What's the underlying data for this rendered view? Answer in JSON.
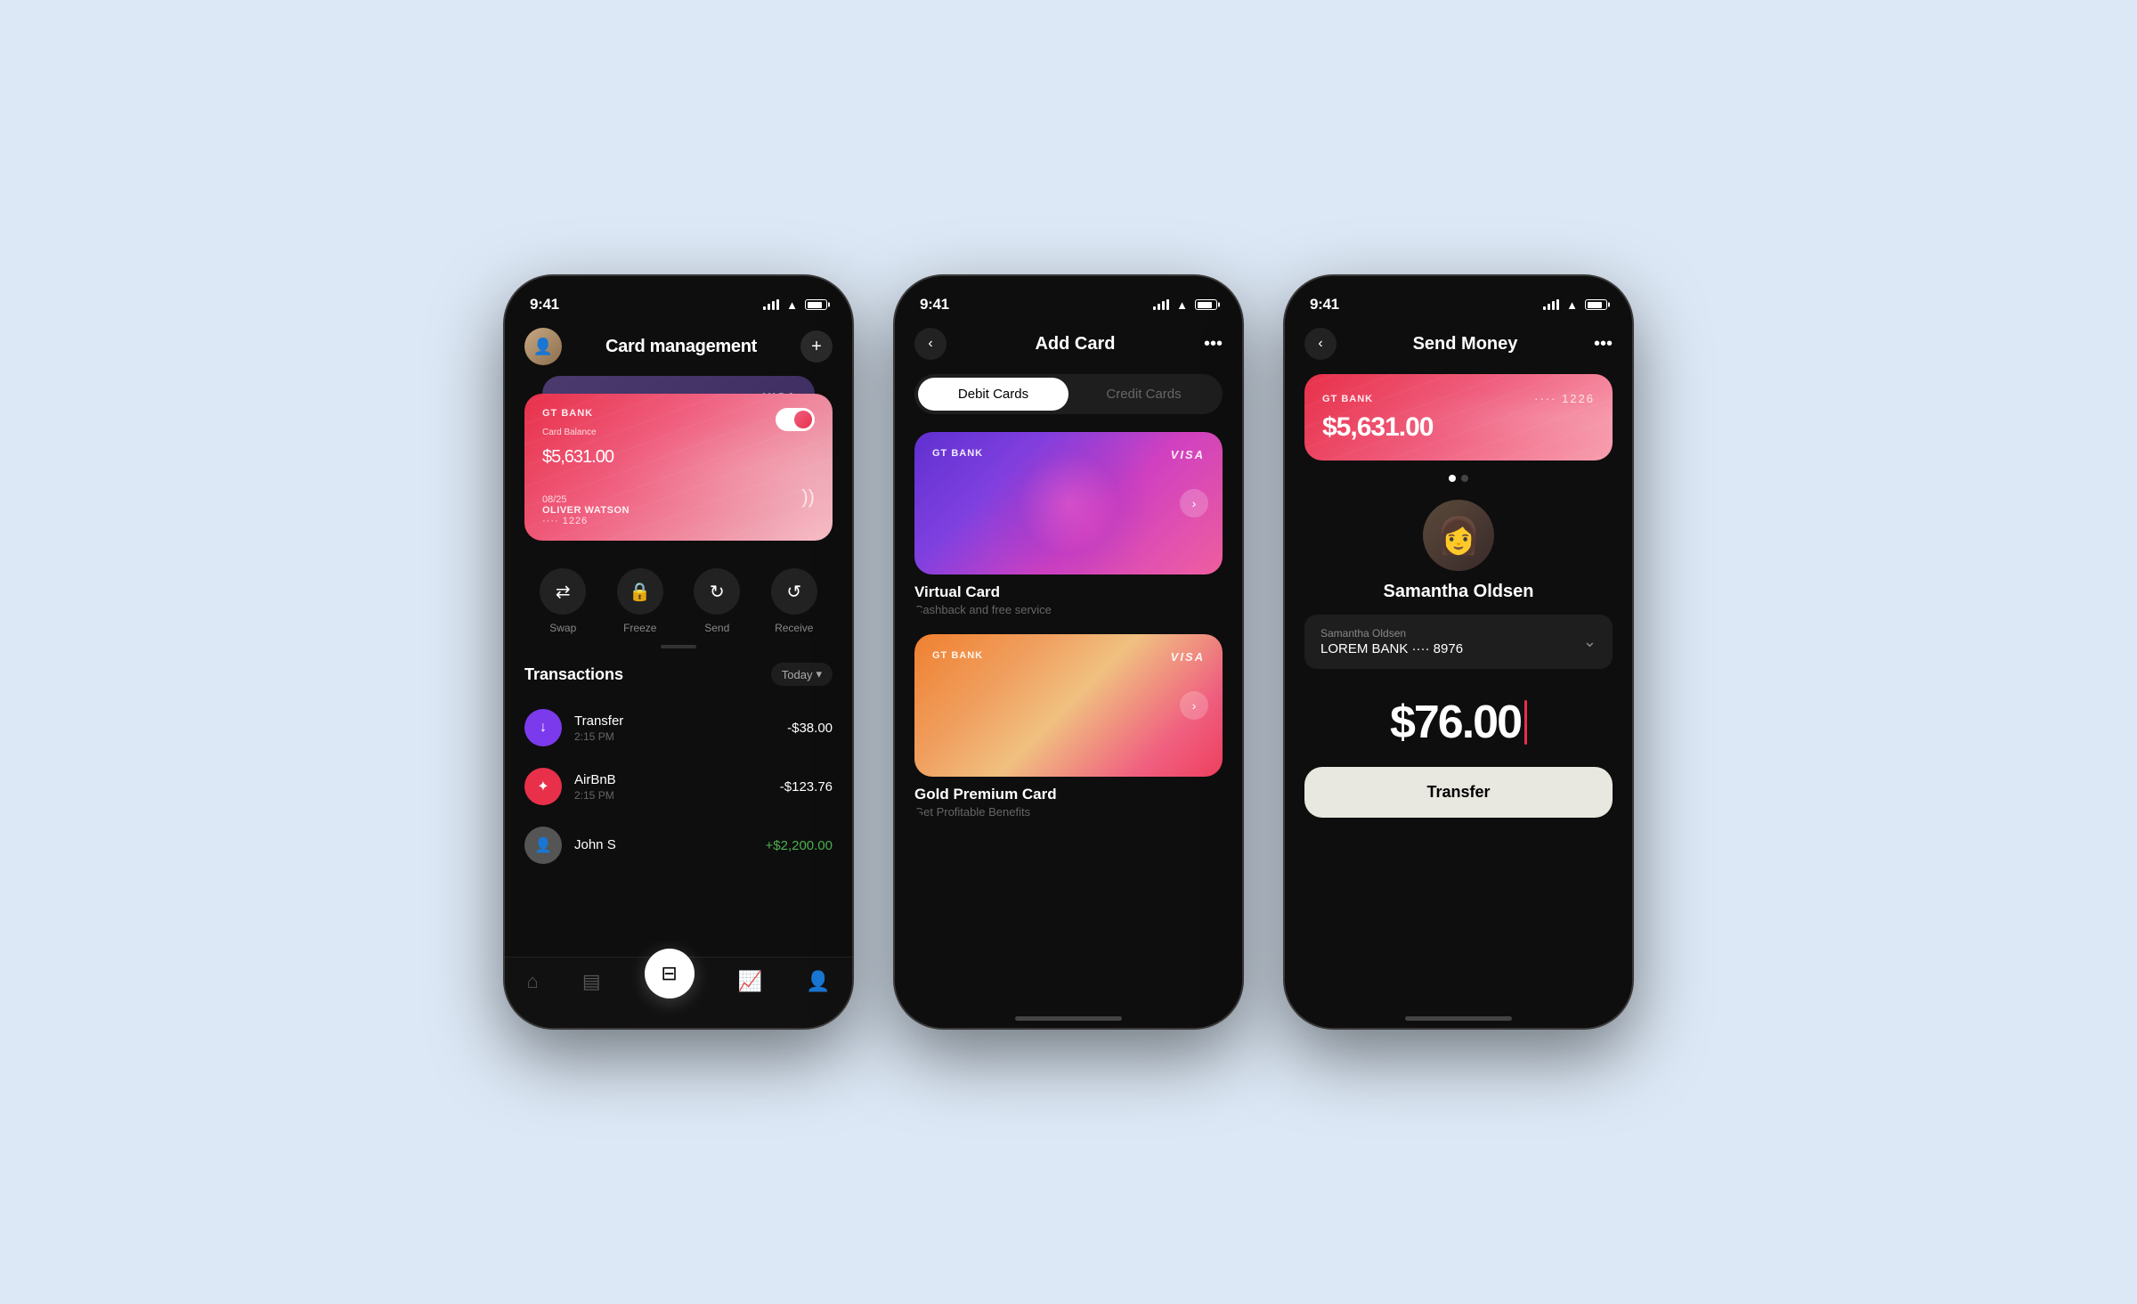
{
  "background_color": "#dce8f5",
  "phone1": {
    "status_time": "9:41",
    "title": "Card  management",
    "card": {
      "bank": "GT BANK",
      "balance_label": "Card Balance",
      "balance": "$5,631.",
      "balance_cents": "00",
      "expiry": "08/25",
      "holder": "OLIVER WATSON",
      "number": "···· 1226",
      "visa_back": "VISA"
    },
    "actions": [
      {
        "icon": "⇄",
        "label": "Swap"
      },
      {
        "icon": "🔒",
        "label": "Freeze"
      },
      {
        "icon": "↻",
        "label": "Send"
      },
      {
        "icon": "↺",
        "label": "Receive"
      }
    ],
    "transactions_title": "Transactions",
    "filter": "Today",
    "transactions": [
      {
        "name": "Transfer",
        "time": "2:15 PM",
        "amount": "-$38.00",
        "type": "negative",
        "icon_color": "#7c3aed",
        "icon": "↓"
      },
      {
        "name": "AirBnB",
        "time": "2:15 PM",
        "amount": "-$123.76",
        "type": "negative",
        "icon_color": "#e8304a",
        "icon": "✦"
      },
      {
        "name": "John S",
        "time": "",
        "amount": "+$2,200.00",
        "type": "positive",
        "icon": "👤"
      }
    ],
    "nav": [
      "🏠",
      "💳",
      "wallet",
      "📈",
      "👤"
    ]
  },
  "phone2": {
    "status_time": "9:41",
    "title": "Add Card",
    "tabs": [
      "Debit Cards",
      "Credit Cards"
    ],
    "active_tab": 0,
    "cards": [
      {
        "type": "Virtual Card",
        "description": "Cashback and free service",
        "bank": "GT BANK",
        "network": "VISA"
      },
      {
        "type": "Gold Premium Card",
        "description": "Get Profitable Benefits",
        "bank": "GT BANK",
        "network": "VISA"
      }
    ]
  },
  "phone3": {
    "status_time": "9:41",
    "title": "Send Money",
    "card": {
      "bank": "GT BANK",
      "number": "···· 1226",
      "balance": "$5,631.00"
    },
    "recipient": {
      "name": "Samantha Oldsen",
      "bank_label": "Samantha Oldsen",
      "bank": "LOREM BANK",
      "account": "···· 8976"
    },
    "amount": "$76.00",
    "transfer_label": "Transfer",
    "dots": [
      true,
      false
    ]
  }
}
